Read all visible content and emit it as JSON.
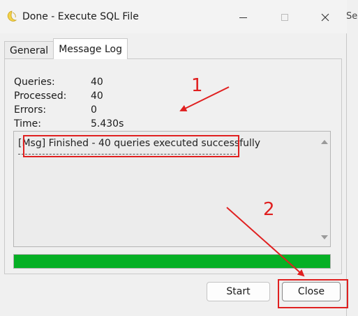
{
  "window": {
    "title": "Done - Execute SQL File",
    "background_peek_text": "Sele"
  },
  "tabs": [
    {
      "label": "General",
      "active": false
    },
    {
      "label": "Message Log",
      "active": true
    }
  ],
  "stats": [
    {
      "label": "Queries:",
      "value": "40"
    },
    {
      "label": "Processed:",
      "value": "40"
    },
    {
      "label": "Errors:",
      "value": "0"
    },
    {
      "label": "Time:",
      "value": "5.430s"
    }
  ],
  "log": {
    "line": "[Msg] Finished - 40 queries executed successfully"
  },
  "progress": {
    "value": 1.0,
    "color": "#06b025"
  },
  "buttons": {
    "start": "Start",
    "close": "Close"
  },
  "annotations": {
    "color": "#e02020",
    "labels": [
      "1",
      "2"
    ]
  },
  "icons": {
    "app": "navicat-icon",
    "minimize": "minimize-icon",
    "maximize": "maximize-icon",
    "close": "close-icon"
  }
}
